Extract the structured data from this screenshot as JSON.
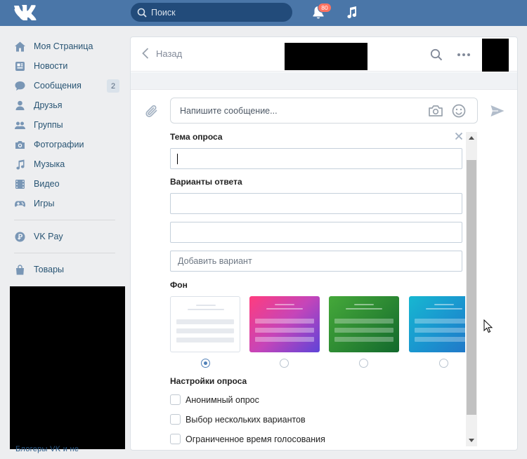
{
  "header": {
    "search_placeholder": "Поиск",
    "notifications_count": "80",
    "colors": {
      "bar": "#4a76a8",
      "badge": "#ff7361"
    }
  },
  "sidebar": {
    "items": [
      {
        "label": "Моя Страница",
        "icon": "home-icon"
      },
      {
        "label": "Новости",
        "icon": "news-icon"
      },
      {
        "label": "Сообщения",
        "icon": "messages-icon",
        "count": "2"
      },
      {
        "label": "Друзья",
        "icon": "friend-icon"
      },
      {
        "label": "Группы",
        "icon": "groups-icon"
      },
      {
        "label": "Фотографии",
        "icon": "camera-icon"
      },
      {
        "label": "Музыка",
        "icon": "music-icon"
      },
      {
        "label": "Видео",
        "icon": "video-icon"
      },
      {
        "label": "Игры",
        "icon": "gamepad-icon"
      }
    ],
    "vkpay": {
      "label": "VK Pay",
      "icon": "vkpay-icon"
    },
    "goods": {
      "label": "Товары",
      "icon": "bag-icon"
    },
    "truncated_text": "Блогеры VK и не"
  },
  "chat": {
    "back_label": "Назад",
    "message_placeholder": "Напишите сообщение..."
  },
  "poll": {
    "topic_heading": "Тема опроса",
    "options_heading": "Варианты ответа",
    "add_option_placeholder": "Добавить вариант",
    "background_heading": "Фон",
    "backgrounds": [
      {
        "name": "white",
        "selected": true
      },
      {
        "name": "pink-purple",
        "selected": false
      },
      {
        "name": "green",
        "selected": false
      },
      {
        "name": "blue",
        "selected": false
      }
    ],
    "settings_heading": "Настройки опроса",
    "settings": [
      {
        "label": "Анонимный опрос",
        "checked": false
      },
      {
        "label": "Выбор нескольких вариантов",
        "checked": false
      },
      {
        "label": "Ограниченное время голосования",
        "checked": false
      }
    ]
  }
}
